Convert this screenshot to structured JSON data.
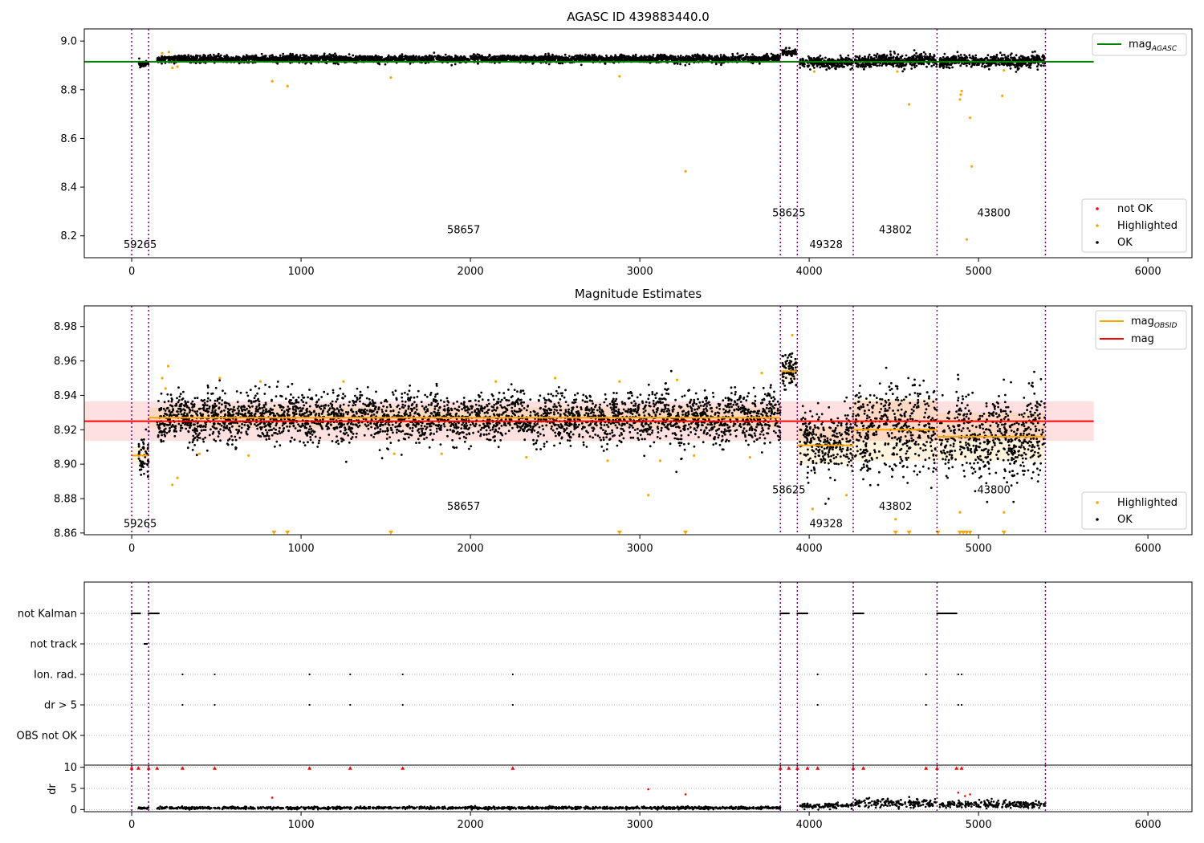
{
  "chart_data": [
    {
      "type": "scatter",
      "title": "AGASC ID 439883440.0",
      "xlabel": "",
      "ylabel": "",
      "xlim": [
        -280,
        6260
      ],
      "ylim": [
        8.11,
        9.05
      ],
      "xticks": [
        0,
        1000,
        2000,
        3000,
        4000,
        5000,
        6000
      ],
      "yticks": [
        8.2,
        8.4,
        8.6,
        8.8,
        9.0
      ],
      "grid": false,
      "legends": [
        {
          "placement": "top-right",
          "entries": [
            {
              "name": "mag",
              "sub": "AGASC",
              "color": "#008000",
              "kind": "line"
            }
          ]
        },
        {
          "placement": "bottom-right",
          "entries": [
            {
              "name": "not OK",
              "color": "#ff0000",
              "kind": "dot"
            },
            {
              "name": "Highlighted",
              "color": "#ffa500",
              "kind": "dot"
            },
            {
              "name": "OK",
              "color": "#000000",
              "kind": "dot"
            }
          ]
        }
      ],
      "reference_line": {
        "name": "mag_AGASC",
        "y": 8.915,
        "x_range": [
          -280,
          5680
        ],
        "color": "#008000"
      },
      "segments": [
        {
          "x0": 40,
          "x1": 100,
          "y": 8.905,
          "spread": 0.006
        },
        {
          "x0": 150,
          "x1": 3830,
          "y": 8.927,
          "spread": 0.007
        },
        {
          "x0": 3840,
          "x1": 3925,
          "y": 8.955,
          "spread": 0.006
        },
        {
          "x0": 3945,
          "x1": 4260,
          "y": 8.912,
          "spread": 0.01
        },
        {
          "x0": 4270,
          "x1": 4755,
          "y": 8.92,
          "spread": 0.013
        },
        {
          "x0": 4770,
          "x1": 5395,
          "y": 8.917,
          "spread": 0.012
        }
      ],
      "highlighted_points": [
        {
          "x": 180,
          "y": 8.95
        },
        {
          "x": 220,
          "y": 8.955
        },
        {
          "x": 240,
          "y": 8.89
        },
        {
          "x": 270,
          "y": 8.895
        },
        {
          "x": 830,
          "y": 8.835
        },
        {
          "x": 920,
          "y": 8.815
        },
        {
          "x": 1530,
          "y": 8.85
        },
        {
          "x": 2880,
          "y": 8.855
        },
        {
          "x": 3270,
          "y": 8.465
        },
        {
          "x": 4030,
          "y": 8.875
        },
        {
          "x": 4520,
          "y": 8.875
        },
        {
          "x": 4590,
          "y": 8.74
        },
        {
          "x": 4890,
          "y": 8.76
        },
        {
          "x": 4895,
          "y": 8.78
        },
        {
          "x": 4900,
          "y": 8.795
        },
        {
          "x": 4930,
          "y": 8.185
        },
        {
          "x": 4950,
          "y": 8.685
        },
        {
          "x": 4960,
          "y": 8.485
        },
        {
          "x": 5140,
          "y": 8.775
        },
        {
          "x": 5150,
          "y": 8.88
        }
      ],
      "obs_boundaries": [
        0,
        100,
        3830,
        3930,
        4260,
        4755,
        5395
      ],
      "obs_labels": [
        {
          "text": "59265",
          "x": 50,
          "y": 8.15
        },
        {
          "text": "58657",
          "x": 1960,
          "y": 8.21
        },
        {
          "text": "58625",
          "x": 3880,
          "y": 8.28
        },
        {
          "text": "49328",
          "x": 4100,
          "y": 8.15
        },
        {
          "text": "43802",
          "x": 4510,
          "y": 8.21
        },
        {
          "text": "43800",
          "x": 5090,
          "y": 8.28
        }
      ]
    },
    {
      "type": "scatter",
      "title": "Magnitude Estimates",
      "xlabel": "",
      "ylabel": "",
      "xlim": [
        -280,
        6260
      ],
      "ylim": [
        8.859,
        8.992
      ],
      "xticks": [
        0,
        1000,
        2000,
        3000,
        4000,
        5000,
        6000
      ],
      "yticks": [
        8.86,
        8.88,
        8.9,
        8.92,
        8.94,
        8.96,
        8.98
      ],
      "grid": false,
      "legends": [
        {
          "placement": "top-right",
          "entries": [
            {
              "name": "mag",
              "sub": "OBSID",
              "color": "#ffa500",
              "kind": "line"
            },
            {
              "name": "mag",
              "sub": "",
              "color": "#ff0000",
              "kind": "line"
            }
          ]
        },
        {
          "placement": "bottom-right",
          "entries": [
            {
              "name": "Highlighted",
              "color": "#ffa500",
              "kind": "dot"
            },
            {
              "name": "OK",
              "color": "#000000",
              "kind": "dot"
            }
          ]
        }
      ],
      "reference_line": {
        "name": "mag",
        "y": 8.925,
        "x_range": [
          -280,
          5680
        ],
        "color": "#ff0000",
        "band": [
          8.9135,
          8.9365
        ]
      },
      "obsid_mags": [
        {
          "x0": 0,
          "x1": 100,
          "y": 8.905,
          "band": [
            8.9,
            8.91
          ]
        },
        {
          "x0": 100,
          "x1": 3830,
          "y": 8.927,
          "band": [
            8.921,
            8.933
          ]
        },
        {
          "x0": 3830,
          "x1": 3930,
          "y": 8.954,
          "band": [
            8.948,
            8.96
          ]
        },
        {
          "x0": 3930,
          "x1": 4260,
          "y": 8.911,
          "band": [
            8.9,
            8.922
          ]
        },
        {
          "x0": 4260,
          "x1": 4755,
          "y": 8.92,
          "band": [
            8.902,
            8.938
          ]
        },
        {
          "x0": 4755,
          "x1": 5395,
          "y": 8.916,
          "band": [
            8.902,
            8.93
          ]
        }
      ],
      "segments": [
        {
          "x0": 40,
          "x1": 100,
          "y": 8.905,
          "spread": 0.006
        },
        {
          "x0": 150,
          "x1": 3830,
          "y": 8.927,
          "spread": 0.007
        },
        {
          "x0": 3840,
          "x1": 3925,
          "y": 8.955,
          "spread": 0.005
        },
        {
          "x0": 3945,
          "x1": 4260,
          "y": 8.911,
          "spread": 0.01
        },
        {
          "x0": 4270,
          "x1": 4755,
          "y": 8.92,
          "spread": 0.013
        },
        {
          "x0": 4770,
          "x1": 5395,
          "y": 8.916,
          "spread": 0.012
        }
      ],
      "highlighted_points": [
        {
          "x": 180,
          "y": 8.95
        },
        {
          "x": 200,
          "y": 8.944
        },
        {
          "x": 215,
          "y": 8.957
        },
        {
          "x": 240,
          "y": 8.888
        },
        {
          "x": 270,
          "y": 8.892
        },
        {
          "x": 400,
          "y": 8.906
        },
        {
          "x": 520,
          "y": 8.95
        },
        {
          "x": 690,
          "y": 8.905
        },
        {
          "x": 760,
          "y": 8.948
        },
        {
          "x": 1250,
          "y": 8.948
        },
        {
          "x": 1550,
          "y": 8.906
        },
        {
          "x": 1830,
          "y": 8.906
        },
        {
          "x": 2150,
          "y": 8.948
        },
        {
          "x": 2330,
          "y": 8.904
        },
        {
          "x": 2500,
          "y": 8.95
        },
        {
          "x": 2810,
          "y": 8.902
        },
        {
          "x": 2880,
          "y": 8.948
        },
        {
          "x": 3050,
          "y": 8.882
        },
        {
          "x": 3120,
          "y": 8.902
        },
        {
          "x": 3220,
          "y": 8.949
        },
        {
          "x": 3320,
          "y": 8.905
        },
        {
          "x": 3650,
          "y": 8.904
        },
        {
          "x": 3720,
          "y": 8.953
        },
        {
          "x": 3900,
          "y": 8.975
        },
        {
          "x": 4020,
          "y": 8.874
        },
        {
          "x": 4220,
          "y": 8.882
        },
        {
          "x": 4510,
          "y": 8.868
        },
        {
          "x": 4890,
          "y": 8.872
        },
        {
          "x": 5150,
          "y": 8.872
        }
      ],
      "clipped_points_x": [
        840,
        920,
        1530,
        2880,
        3270,
        4510,
        4590,
        4760,
        4890,
        4910,
        4930,
        4950,
        5150
      ],
      "obs_boundaries": [
        0,
        100,
        3830,
        3930,
        4260,
        4755,
        5395
      ],
      "obs_labels": [
        {
          "text": "59265",
          "x": 50,
          "y": 8.8635
        },
        {
          "text": "58657",
          "x": 1960,
          "y": 8.8735
        },
        {
          "text": "58625",
          "x": 3880,
          "y": 8.883
        },
        {
          "text": "49328",
          "x": 4100,
          "y": 8.8635
        },
        {
          "text": "43802",
          "x": 4510,
          "y": 8.8735
        },
        {
          "text": "43800",
          "x": 5090,
          "y": 8.883
        }
      ]
    },
    {
      "type": "scatter",
      "title": "",
      "xlabel": "",
      "ylabel": "",
      "xlim": [
        -280,
        6260
      ],
      "grid": true,
      "flag_rows": [
        "not Kalman",
        "not track",
        "Ion. rad.",
        "dr > 5",
        "OBS not OK"
      ],
      "flags": {
        "not Kalman": [
          [
            0,
            50
          ],
          [
            100,
            160
          ],
          [
            3830,
            3880
          ],
          [
            3930,
            3990
          ],
          [
            4260,
            4320
          ],
          [
            4755,
            4870
          ]
        ],
        "not track": [
          [
            75,
            90
          ]
        ],
        "Ion. rad.": [
          300,
          490,
          1050,
          1290,
          1600,
          2250,
          4050,
          4690,
          4880,
          4900
        ],
        "dr > 5": [
          300,
          490,
          1050,
          1290,
          1600,
          2250,
          4050,
          4690,
          4880,
          4900
        ],
        "OBS not OK": []
      },
      "dr_panel": {
        "ylabel": "dr",
        "yticks": [
          0,
          5,
          10
        ],
        "ylim": [
          -0.5,
          10.5
        ],
        "clipped_x": [
          0,
          40,
          100,
          150,
          300,
          490,
          1050,
          1290,
          1600,
          2250,
          3830,
          3880,
          3930,
          3990,
          4050,
          4260,
          4320,
          4690,
          4755,
          4870,
          4900
        ],
        "outliers": [
          {
            "x": 830,
            "y": 2.8
          },
          {
            "x": 3050,
            "y": 4.8
          },
          {
            "x": 3270,
            "y": 3.6
          },
          {
            "x": 4880,
            "y": 4.0
          },
          {
            "x": 4920,
            "y": 3.2
          },
          {
            "x": 4950,
            "y": 3.6
          }
        ],
        "segments": [
          {
            "x0": 40,
            "x1": 100,
            "y": 0.4
          },
          {
            "x0": 150,
            "x1": 3830,
            "y": 0.4
          },
          {
            "x0": 3945,
            "x1": 4260,
            "y": 0.9
          },
          {
            "x0": 4270,
            "x1": 4755,
            "y": 1.6
          },
          {
            "x0": 4770,
            "x1": 5395,
            "y": 1.2
          }
        ]
      },
      "obs_boundaries": [
        0,
        100,
        3830,
        3930,
        4260,
        4755,
        5395
      ]
    }
  ]
}
